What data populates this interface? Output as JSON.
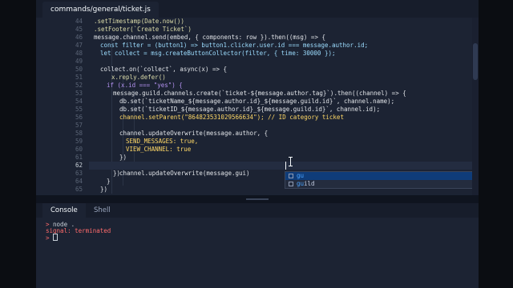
{
  "tab": {
    "title": "commands/general/ticket.js"
  },
  "editor": {
    "line_numbers": [
      "44",
      "45",
      "46",
      "47",
      "48",
      "49",
      "50",
      "51",
      "52",
      "53",
      "54",
      "55",
      "56",
      "57",
      "58",
      "59",
      "60",
      "61",
      "62",
      "63",
      "64",
      "65"
    ],
    "lines": [
      ".setTimestamp(Date.now())",
      ".setFooter(`Create Ticket`)",
      "message.channel.send(embed, { components: row }).then((msg) => {",
      "const filter = (button1) => button1.clicker.user.id === message.author.id;",
      "let collect = msg.createButtonCollector(filter, { time: 30000 });",
      "",
      "collect.on(`collect`, async(x) => {",
      "x.reply.defer()",
      "if (x.id === \"yes\") {",
      "message.guild.channels.create(`ticket-${message.author.tag}`).then((channel) => {",
      "db.set(`ticketName_${message.author.id}_${message.guild.id}`, channel.name);",
      "db.set(`ticketID_${message.author.id}_${message.guild.id}`, channel.id);",
      "channel.setParent(\"864823531029566634\"); // ID category ticket",
      "",
      "channel.updateOverwrite(message.author, {",
      "SEND_MESSAGES: true,",
      "VIEW_CHANNEL: true",
      "})",
      "channel.updateOverwrite(message.gui)",
      "})",
      "}",
      "})"
    ]
  },
  "autocomplete": {
    "items": [
      {
        "match": "gu",
        "rest": ""
      },
      {
        "match": "gu",
        "rest": "ild"
      }
    ]
  },
  "console": {
    "tabs": [
      "Console",
      "Shell"
    ],
    "lines": [
      "node .",
      "signal: terminated"
    ],
    "prompt": ">"
  }
}
